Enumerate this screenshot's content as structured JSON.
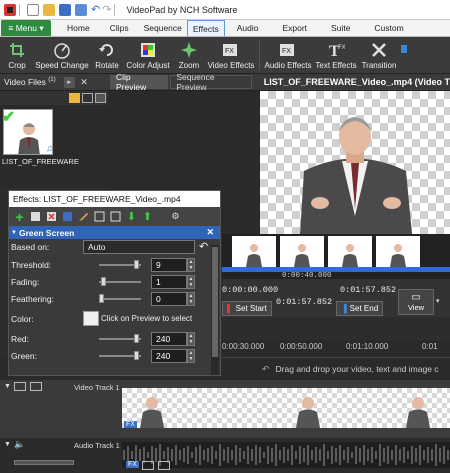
{
  "window": {
    "title": "VideoPad by NCH Software"
  },
  "menu": {
    "menu_label": "≡ Menu ▾",
    "tabs": [
      "Home",
      "Clips",
      "Sequence",
      "Effects",
      "Audio",
      "Export",
      "Suite",
      "Custom"
    ],
    "active_tab": "Effects"
  },
  "ribbon": {
    "buttons": [
      {
        "label": "Crop",
        "icon": "crop-icon"
      },
      {
        "label": "Speed Change",
        "icon": "speed-change-icon"
      },
      {
        "label": "Rotate",
        "icon": "rotate-icon"
      },
      {
        "label": "Color Adjust",
        "icon": "color-adjust-icon"
      },
      {
        "label": "Zoom",
        "icon": "zoom-icon"
      },
      {
        "label": "Video Effects",
        "icon": "video-effects-icon"
      },
      {
        "label": "Audio Effects",
        "icon": "audio-effects-icon"
      },
      {
        "label": "Text Effects",
        "icon": "text-effects-icon"
      },
      {
        "label": "Transition",
        "icon": "transition-icon"
      }
    ]
  },
  "left_panel": {
    "tab_label": "Video Files",
    "tab_count": "(1)",
    "clip_name": "LIST_OF_FREEWARE"
  },
  "preview": {
    "tab_clip": "Clip Preview",
    "tab_sequence": "Sequence Preview",
    "file_title": "LIST_OF_FREEWARE_Video_.mp4 (Video T"
  },
  "transport": {
    "scrub_time": "0:00:40.000",
    "start_time": "0:00:00.000",
    "duration": "0:01:57.852",
    "end_time": "0:01:57.852",
    "set_start": "Set Start",
    "set_end": "Set End",
    "view_label": "View"
  },
  "timeline": {
    "ruler": [
      "0:00:30.000",
      "0:00:50.000",
      "0:01:10.000",
      "0:01"
    ],
    "drop_message": "Drag and drop your video, text and image c",
    "video_track": "Video Track 1",
    "audio_track": "Audio Track 1",
    "fx_badge": "FX"
  },
  "effects_dialog": {
    "title": "Effects: LIST_OF_FREEWARE_Video_.mp4",
    "effect_name": "Green Screen",
    "based_on_label": "Based on:",
    "based_on_value": "Auto",
    "params": [
      {
        "label": "Threshold:",
        "value": "9",
        "level": 0.95
      },
      {
        "label": "Fading:",
        "value": "1",
        "level": 0.05
      },
      {
        "label": "Feathering:",
        "value": "0",
        "level": 0.0
      }
    ],
    "color_label": "Color:",
    "color_hint": "Click on Preview to select",
    "rgb": [
      {
        "label": "Red:",
        "value": "240",
        "level": 0.94
      },
      {
        "label": "Green:",
        "value": "240",
        "level": 0.94
      }
    ]
  },
  "colors": {
    "accent_green": "#2d8a3f",
    "selection_blue": "#2f64b8",
    "timeline_blue": "#2f6bd8"
  }
}
